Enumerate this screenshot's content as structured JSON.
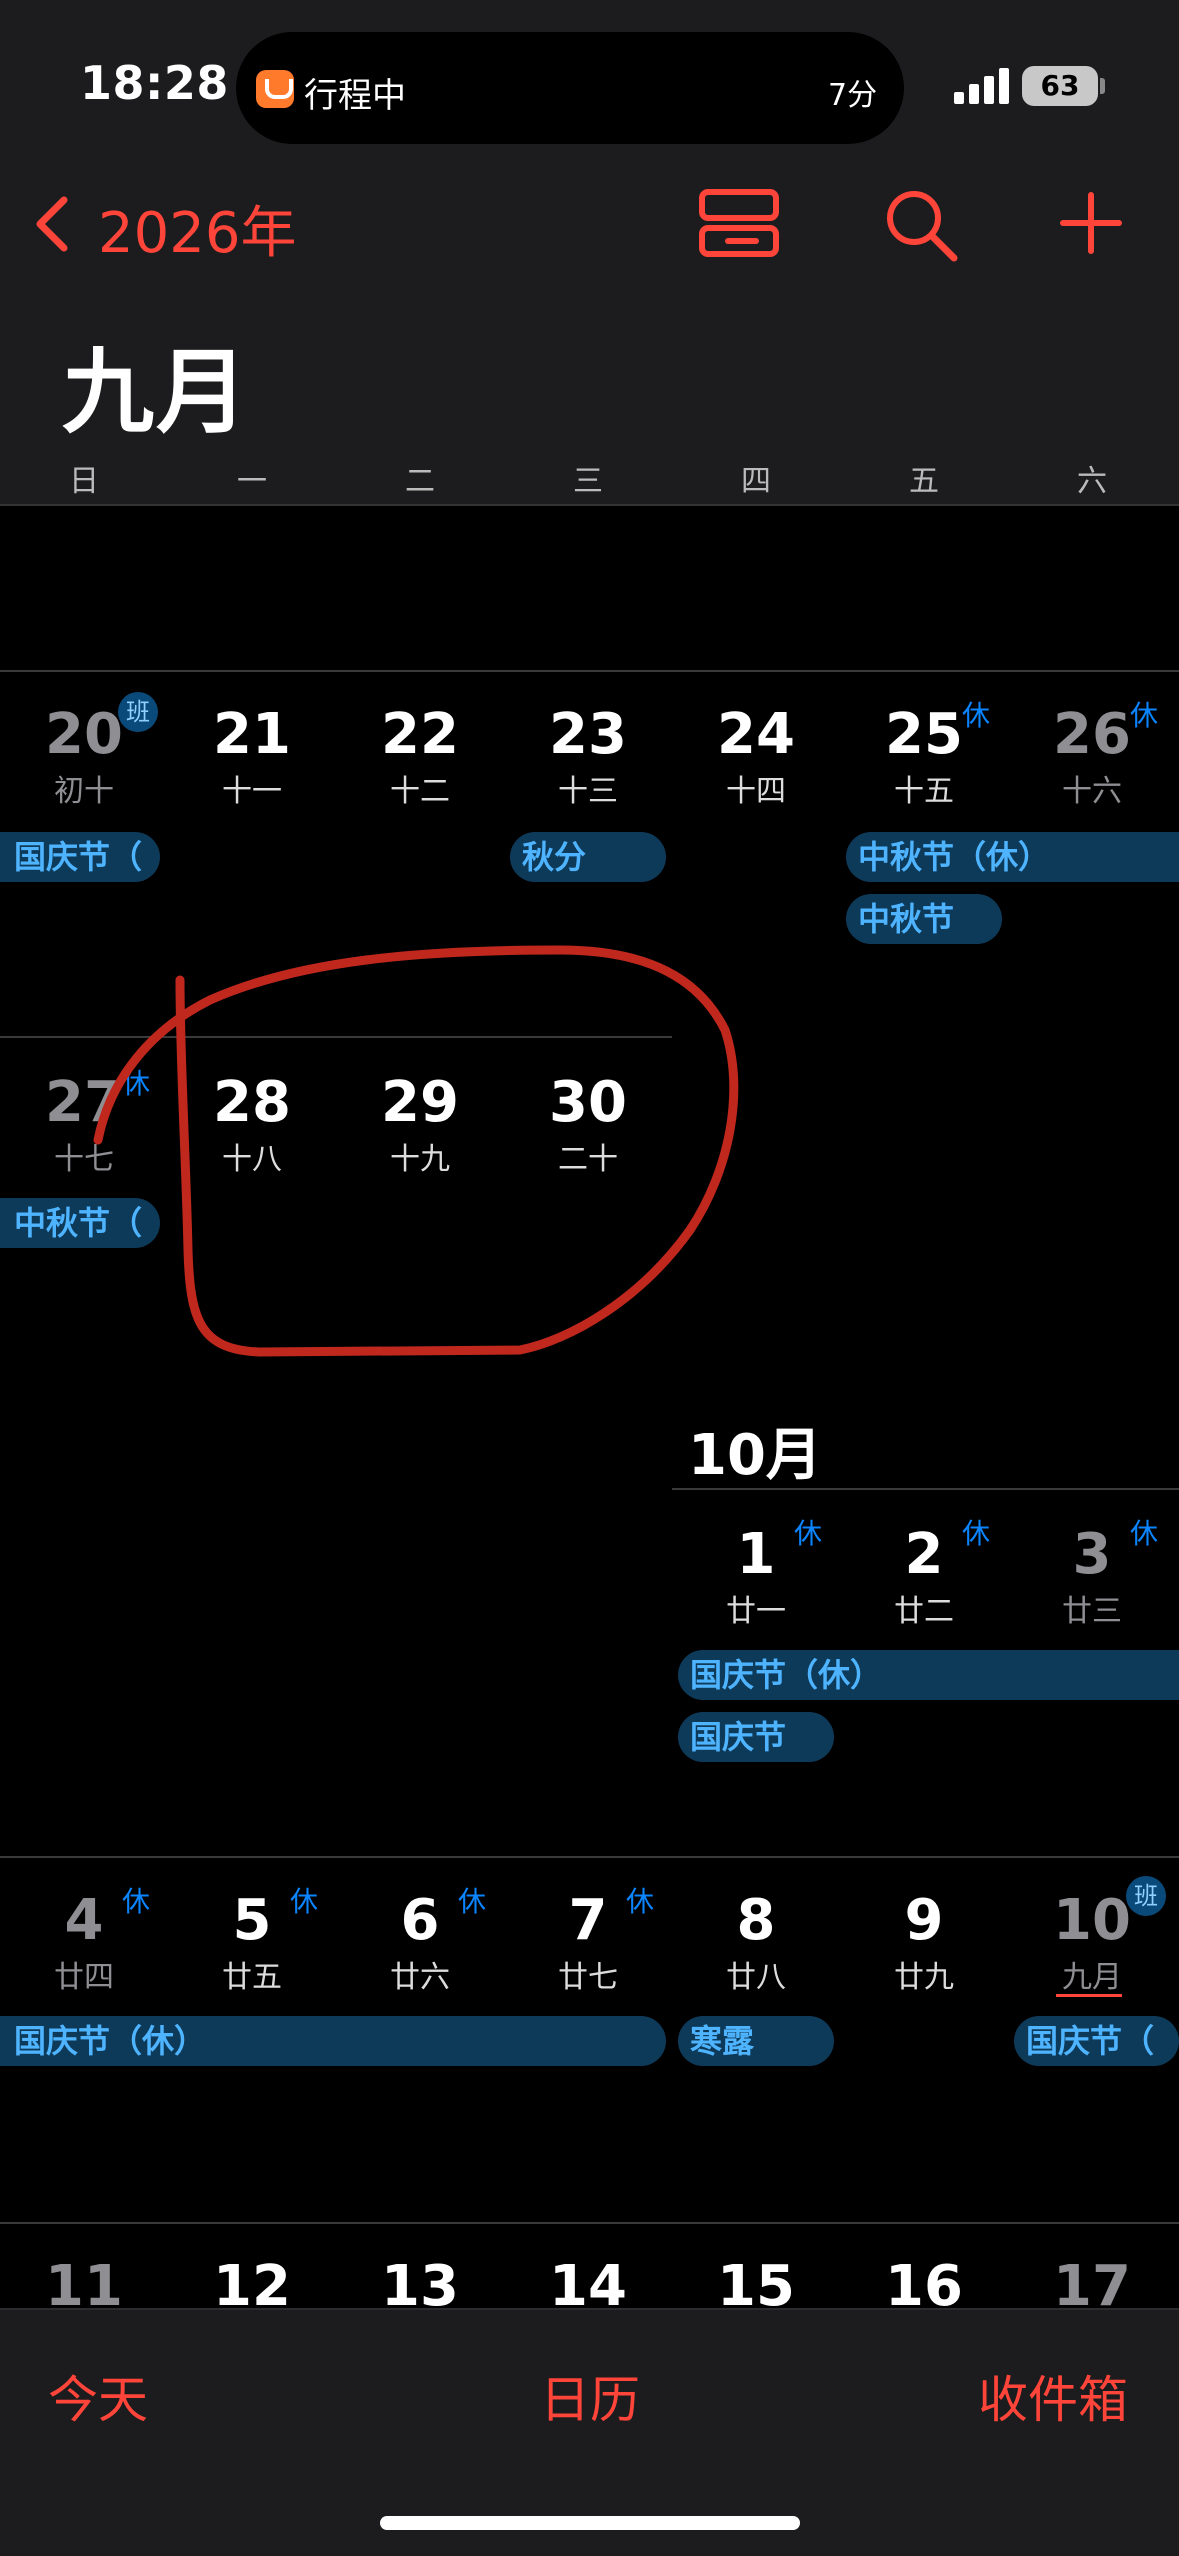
{
  "status_bar": {
    "time": "18:28",
    "island_label": "行程中",
    "island_time": "7分",
    "battery": "63"
  },
  "nav": {
    "back_label": "2026年",
    "back_icon": "chevron-left-icon",
    "list_icon": "list-view-icon",
    "search_icon": "search-icon",
    "add_icon": "plus-icon"
  },
  "month_title": "九月",
  "weekdays": [
    "日",
    "一",
    "二",
    "三",
    "四",
    "五",
    "六"
  ],
  "weeks": {
    "w1": {
      "days": [
        {
          "num": "20",
          "lunar": "初十",
          "muted": true,
          "badge": "班"
        },
        {
          "num": "21",
          "lunar": "十一"
        },
        {
          "num": "22",
          "lunar": "十二"
        },
        {
          "num": "23",
          "lunar": "十三"
        },
        {
          "num": "24",
          "lunar": "十四"
        },
        {
          "num": "25",
          "lunar": "十五",
          "badge": "休"
        },
        {
          "num": "26",
          "lunar": "十六",
          "muted": true,
          "badge": "休"
        }
      ],
      "events": [
        "国庆节（",
        "秋分",
        "中秋节（休）",
        "中秋节"
      ]
    },
    "w2": {
      "days": [
        {
          "num": "27",
          "lunar": "十七",
          "muted": true,
          "badge": "休"
        },
        {
          "num": "28",
          "lunar": "十八"
        },
        {
          "num": "29",
          "lunar": "十九"
        },
        {
          "num": "30",
          "lunar": "二十"
        }
      ],
      "events": [
        "中秋节（"
      ]
    },
    "october_label": "10月",
    "w3": {
      "days": [
        {
          "num": "1",
          "lunar": "廿一",
          "badge": "休"
        },
        {
          "num": "2",
          "lunar": "廿二",
          "badge": "休"
        },
        {
          "num": "3",
          "lunar": "廿三",
          "muted": true,
          "badge": "休"
        }
      ],
      "events": [
        "国庆节（休）",
        "国庆节"
      ]
    },
    "w4": {
      "days": [
        {
          "num": "4",
          "lunar": "廿四",
          "muted": true,
          "badge": "休"
        },
        {
          "num": "5",
          "lunar": "廿五",
          "badge": "休"
        },
        {
          "num": "6",
          "lunar": "廿六",
          "badge": "休"
        },
        {
          "num": "7",
          "lunar": "廿七",
          "badge": "休"
        },
        {
          "num": "8",
          "lunar": "廿八"
        },
        {
          "num": "9",
          "lunar": "廿九"
        },
        {
          "num": "10",
          "lunar": "九月",
          "muted": true,
          "badge": "班"
        }
      ],
      "events": [
        "国庆节（休）",
        "寒露",
        "国庆节（"
      ]
    },
    "w5": {
      "days": [
        {
          "num": "11",
          "muted": true
        },
        {
          "num": "12"
        },
        {
          "num": "13"
        },
        {
          "num": "14"
        },
        {
          "num": "15"
        },
        {
          "num": "16"
        },
        {
          "num": "17",
          "muted": true
        }
      ]
    }
  },
  "tabs": {
    "today": "今天",
    "calendars": "日历",
    "inbox": "收件箱"
  },
  "colors": {
    "accent": "#ff453a",
    "event_bg": "#0e3a5a",
    "event_text": "#4fb4ff",
    "badge": "#0a84ff",
    "annotation": "#c0281e"
  }
}
